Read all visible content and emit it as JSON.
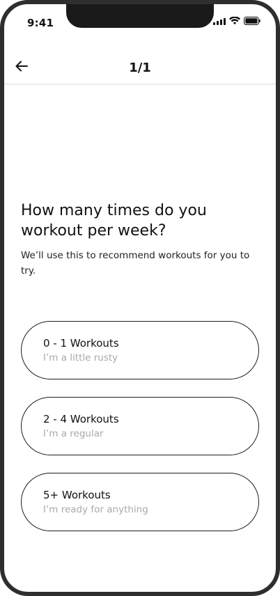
{
  "status_bar": {
    "time": "9:41"
  },
  "nav": {
    "title": "1/1"
  },
  "question": {
    "title": "How many times do you workout per week?",
    "subtitle": "We’ll use this to recommend workouts for you to try."
  },
  "options": [
    {
      "title": "0 - 1 Workouts",
      "subtitle": "I’m a little rusty"
    },
    {
      "title": "2 - 4 Workouts",
      "subtitle": "I’m a regular"
    },
    {
      "title": "5+ Workouts",
      "subtitle": "I’m ready for anything"
    }
  ],
  "icons": {
    "back": "arrow-left-icon",
    "signal": "cellular-signal-icon",
    "wifi": "wifi-icon",
    "battery": "battery-icon"
  },
  "colors": {
    "frame": "#2e2e2e",
    "text": "#111111",
    "muted": "#a9a9a9",
    "divider": "#ececec"
  }
}
